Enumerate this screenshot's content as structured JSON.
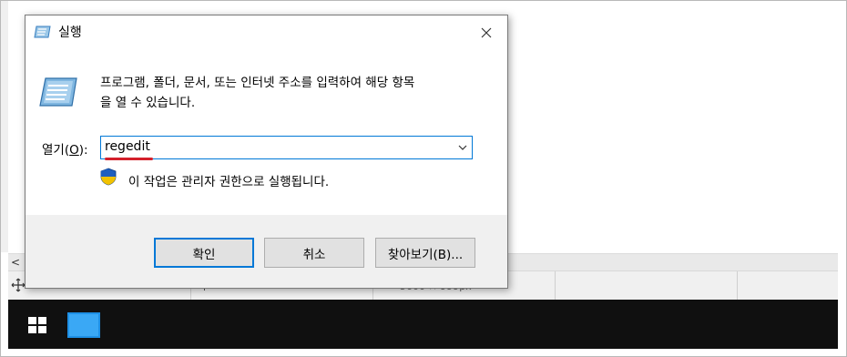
{
  "dialog": {
    "title": "실행",
    "description_line1": "프로그램, 폴더, 문서, 또는 인터넷 주소를 입력하여 해당 항목",
    "description_line2": "을 열 수 있습니다.",
    "open_label_prefix": "열기(",
    "open_label_key": "O",
    "open_label_suffix": "):",
    "open_value": "regedit",
    "admin_note": "이 작업은 관리자 권한으로 실행됩니다.",
    "buttons": {
      "ok": "확인",
      "cancel": "취소",
      "browse": "찾아보기(B)..."
    }
  },
  "background": {
    "status_text": "5600 × 999px",
    "scroll_left_glyph": "<"
  },
  "icons": {
    "title": "run-icon",
    "main": "run-icon",
    "shield": "uac-shield-icon",
    "close": "close-icon",
    "dropdown": "chevron-down-icon",
    "start": "windows-logo-icon",
    "taskbar_app": "app-window-icon"
  },
  "colors": {
    "accent": "#0078d7",
    "highlight_underline": "#d4202b",
    "taskbar": "#101010"
  }
}
